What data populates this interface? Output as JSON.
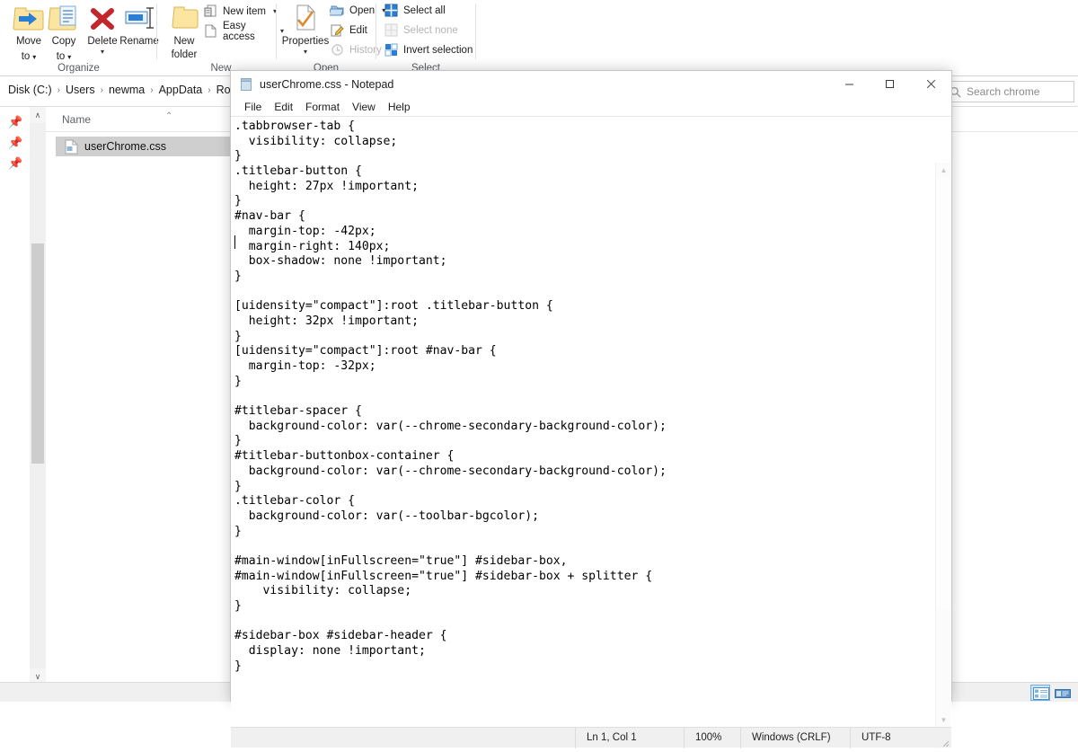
{
  "explorer": {
    "ribbon": {
      "groups": [
        {
          "label": "Organize"
        },
        {
          "label": "New"
        },
        {
          "label": "Open"
        },
        {
          "label": "Select"
        }
      ],
      "organize": {
        "move_to": {
          "line1": "Move",
          "line2": "to",
          "caret": "▾",
          "icon": "folder-arrow-left-icon"
        },
        "copy_to": {
          "line1": "Copy",
          "line2": "to",
          "caret": "▾",
          "icon": "folder-copy-icon"
        },
        "delete": {
          "line1": "Delete",
          "line2": "",
          "caret": "▾",
          "icon": "red-x-icon"
        },
        "rename": {
          "line1": "Rename",
          "line2": "",
          "caret": "",
          "icon": "rename-icon"
        }
      },
      "new": {
        "new_folder": {
          "line1": "New",
          "line2": "folder",
          "icon": "new-folder-icon"
        },
        "new_item": {
          "label": "New item",
          "caret": "▾",
          "icon": "new-item-icon",
          "disabled": false
        },
        "easy_access": {
          "label": "Easy access",
          "caret": "▾",
          "icon": "easy-access-icon",
          "disabled": false
        }
      },
      "open": {
        "properties": {
          "line1": "Properties",
          "line2": "",
          "caret": "▾",
          "icon": "properties-icon"
        },
        "open": {
          "label": "Open",
          "caret": "▾",
          "icon": "open-icon",
          "disabled": false
        },
        "edit": {
          "label": "Edit",
          "caret": "",
          "icon": "edit-icon",
          "disabled": false
        },
        "history": {
          "label": "History",
          "caret": "",
          "icon": "history-icon",
          "disabled": true
        }
      },
      "select": {
        "select_all": {
          "label": "Select all",
          "icon": "select-all-icon",
          "disabled": false
        },
        "select_none": {
          "label": "Select none",
          "icon": "select-none-icon",
          "disabled": true
        },
        "invert_selection": {
          "label": "Invert selection",
          "icon": "invert-selection-icon",
          "disabled": false
        }
      }
    },
    "breadcrumb": {
      "separator": "›",
      "items": [
        "Disk (C:)",
        "Users",
        "newma",
        "AppData",
        "Roar"
      ],
      "dropdown_caret": "⌄"
    },
    "search": {
      "placeholder": "Search chrome",
      "icon": "search-icon"
    },
    "navpane": {
      "pins": [
        "pin-icon",
        "pin-icon",
        "pin-icon"
      ]
    },
    "scrollbar": {
      "up": "∧",
      "down": "∨"
    },
    "list": {
      "columns": [
        "Name"
      ],
      "sort_caret": "⌃",
      "rows": [
        {
          "name": "userChrome.css",
          "icon": "css-file-icon",
          "selected": true
        }
      ]
    },
    "statusbar": {
      "views": [
        {
          "name": "details-view-button",
          "active": true
        },
        {
          "name": "large-icons-view-button",
          "active": false
        }
      ]
    }
  },
  "notepad": {
    "title": "userChrome.css - Notepad",
    "title_icon": "notepad-icon",
    "controls": {
      "minimize": "—",
      "maximize": "☐",
      "close": "✕"
    },
    "menu": [
      "File",
      "Edit",
      "Format",
      "View",
      "Help"
    ],
    "content": ".tabbrowser-tab {\n  visibility: collapse;\n}\n.titlebar-button {\n  height: 27px !important;\n}\n#nav-bar {\n  margin-top: -42px;\n  margin-right: 140px;\n  box-shadow: none !important;\n}\n\n[uidensity=\"compact\"]:root .titlebar-button {\n  height: 32px !important;\n}\n[uidensity=\"compact\"]:root #nav-bar {\n  margin-top: -32px;\n}\n\n#titlebar-spacer {\n  background-color: var(--chrome-secondary-background-color);\n}\n#titlebar-buttonbox-container {\n  background-color: var(--chrome-secondary-background-color);\n}\n.titlebar-color {\n  background-color: var(--toolbar-bgcolor);\n}\n\n#main-window[inFullscreen=\"true\"] #sidebar-box,\n#main-window[inFullscreen=\"true\"] #sidebar-box + splitter {\n    visibility: collapse;\n}\n\n#sidebar-box #sidebar-header {\n  display: none !important;\n}",
    "statusbar": {
      "position": "Ln 1, Col 1",
      "zoom": "100%",
      "line_ending": "Windows (CRLF)",
      "encoding": "UTF-8"
    },
    "scrollbar": {
      "up": "▲",
      "down": "▼"
    }
  },
  "colors": {
    "folder_yellow": "#fbe5a0",
    "folder_border": "#d9b452",
    "delete_red": "#c1272d",
    "accent_blue": "#2a7fd4",
    "selection_gray": "#cfcfcf",
    "ribbon_bg": "#ffffff",
    "status_bg": "#f0f0f0"
  }
}
